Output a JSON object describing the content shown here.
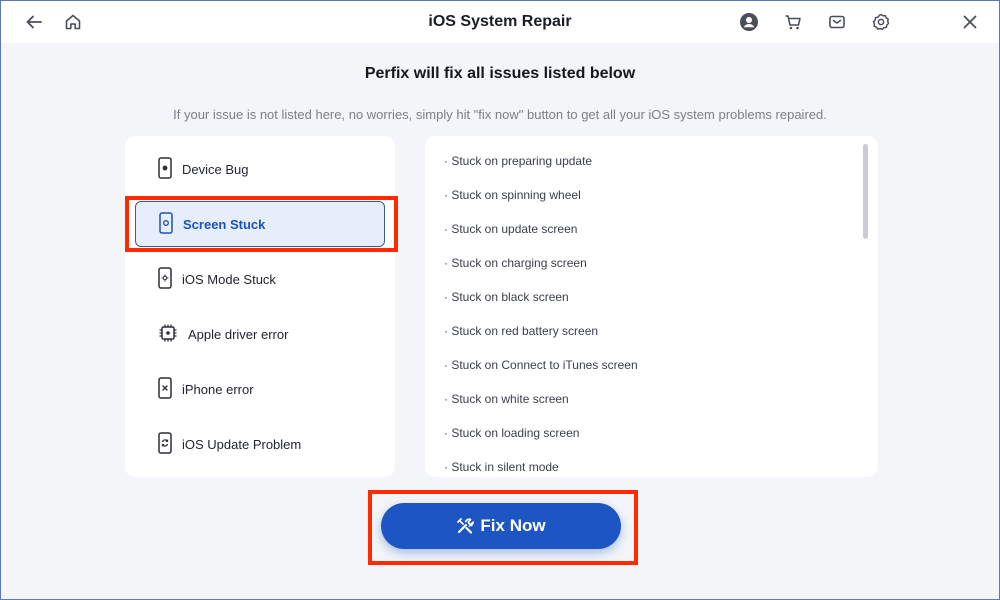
{
  "window": {
    "title": "iOS System Repair",
    "left_icons": [
      "back-arrow-icon",
      "home-icon"
    ],
    "right_icons": [
      "account-icon",
      "cart-icon",
      "mail-icon",
      "settings-icon",
      "close-icon"
    ]
  },
  "headline": "Perfix will fix all issues listed below",
  "subline": "If your issue is not listed here, no worries, simply hit \"fix now\" button to get all your iOS system problems repaired.",
  "categories": [
    {
      "label": "Device Bug",
      "icon": "device-bug-icon",
      "active": false
    },
    {
      "label": "Screen Stuck",
      "icon": "screen-stuck-icon",
      "active": true
    },
    {
      "label": "iOS Mode Stuck",
      "icon": "ios-mode-icon",
      "active": false
    },
    {
      "label": "Apple driver error",
      "icon": "chip-icon",
      "active": false
    },
    {
      "label": "iPhone error",
      "icon": "phone-error-icon",
      "active": false
    },
    {
      "label": "iOS Update Problem",
      "icon": "update-icon",
      "active": false
    }
  ],
  "issues": [
    "· Stuck on preparing update",
    "· Stuck on spinning wheel",
    "· Stuck on update screen",
    "· Stuck on charging screen",
    "· Stuck on black screen",
    "· Stuck on red battery screen",
    "· Stuck on Connect to iTunes screen",
    "· Stuck on white screen",
    "· Stuck on loading screen",
    "· Stuck in silent mode"
  ],
  "fix_button": {
    "label": "Fix Now",
    "icon": "wrench-icon"
  },
  "colors": {
    "accent": "#1d56c2",
    "highlight": "#ff2a00",
    "active_bg": "#e6eefb",
    "background": "#f3f5f9"
  }
}
